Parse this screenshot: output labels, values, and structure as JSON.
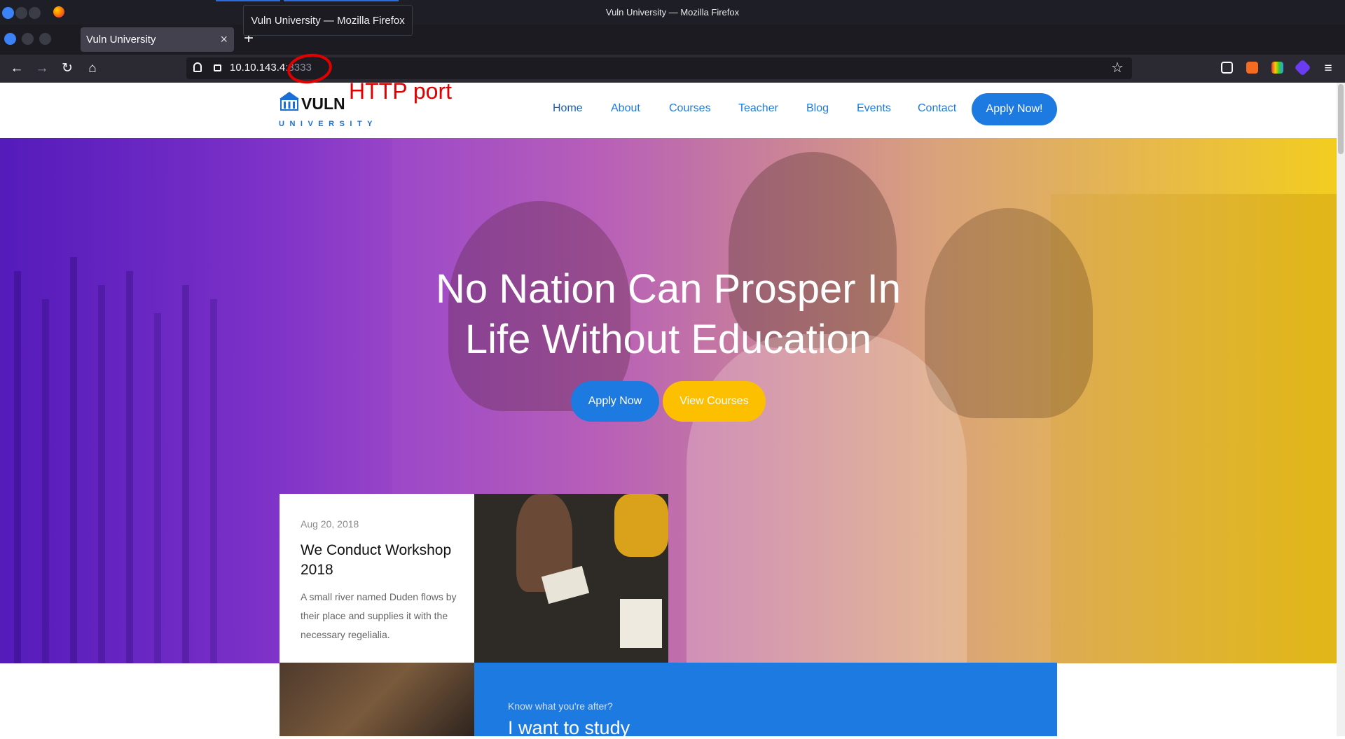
{
  "window": {
    "title": "Vuln University — Mozilla Firefox",
    "tooltip": "Vuln University — Mozilla Firefox"
  },
  "tab": {
    "label": "Vuln University",
    "close": "×"
  },
  "newtab": "+",
  "nav": {
    "back_icon": "arrow-left-icon",
    "forward_icon": "arrow-right-icon",
    "reload_icon": "reload-icon",
    "home_icon": "home-icon",
    "url_host": "10.10.143.4",
    "url_port": ":3333"
  },
  "annotation": {
    "text": "HTTP port",
    "color": "#e00000"
  },
  "site": {
    "logo_word": "VULN",
    "logo_sub": "UNIVERSITY",
    "menu": [
      "Home",
      "About",
      "Courses",
      "Teacher",
      "Blog",
      "Events",
      "Contact"
    ],
    "cta": "Apply Now!"
  },
  "hero": {
    "title_line1": "No Nation Can Prosper In",
    "title_line2": "Life Without Education",
    "btn_apply": "Apply Now",
    "btn_view": "View Courses"
  },
  "card": {
    "date": "Aug 20, 2018",
    "title": "We Conduct Workshop 2018",
    "text": "A small river named Duden flows by their place and supplies it with the necessary regelialia."
  },
  "bottom": {
    "sub": "Know what you're after?",
    "title": "I want to study"
  },
  "colors": {
    "accent": "#1d7ae0",
    "yellow": "#fcc000"
  }
}
